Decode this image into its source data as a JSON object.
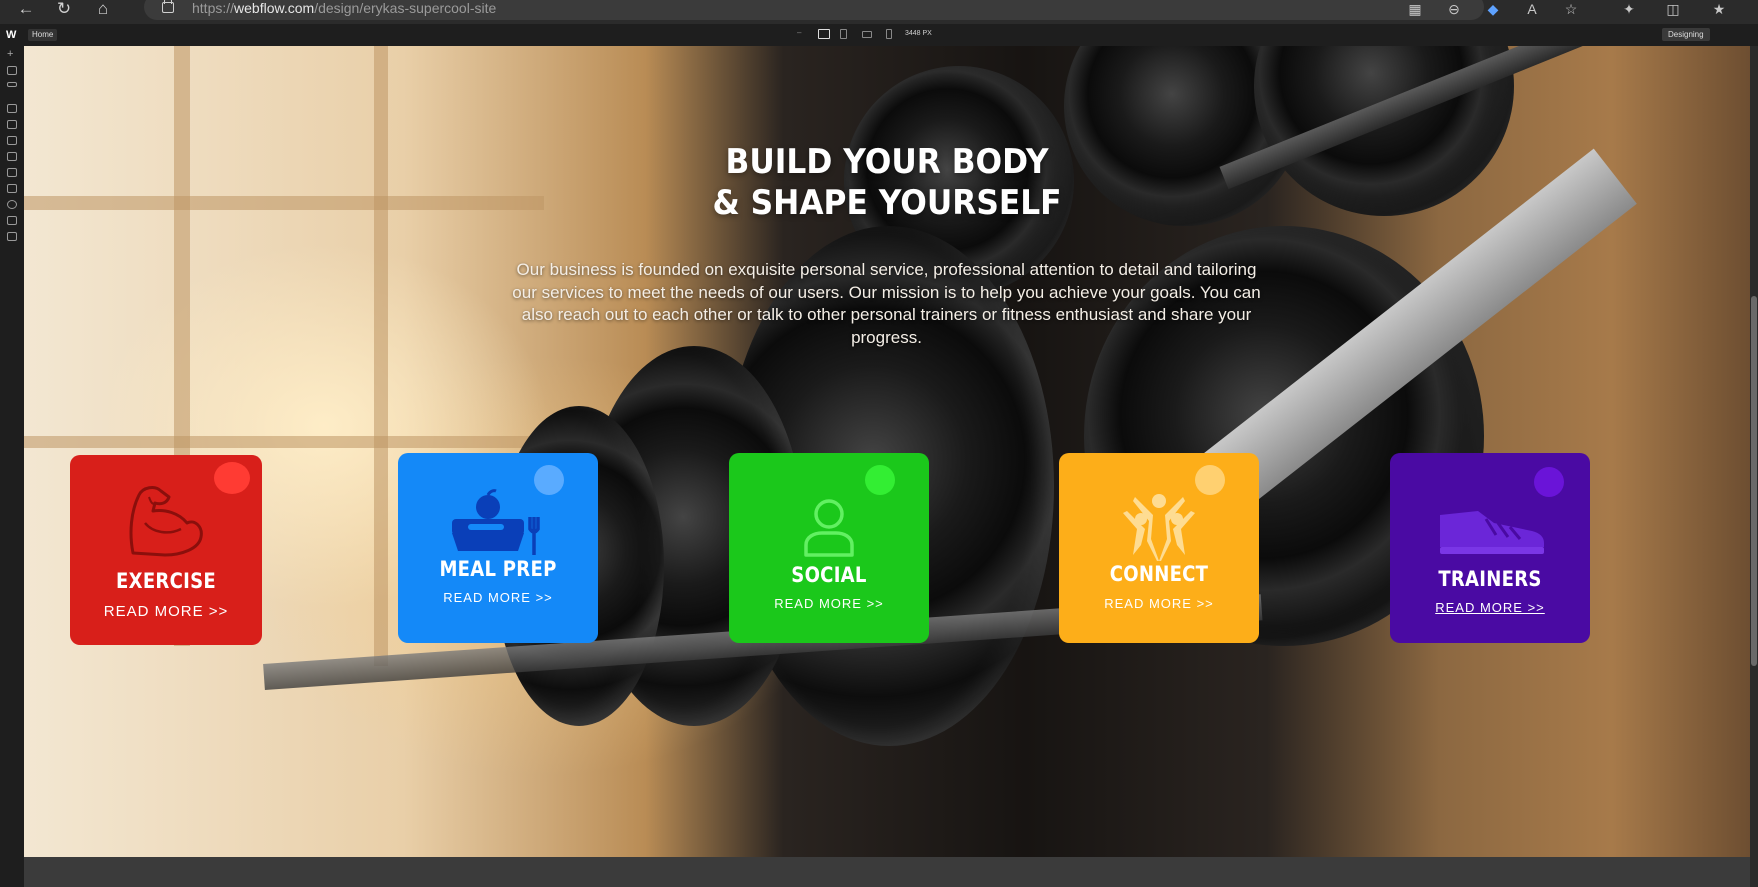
{
  "browser": {
    "url_prefix": "https://",
    "url_domain": "webflow.com",
    "url_path": "/design/erykas-supercool-site"
  },
  "designer": {
    "logo": "W",
    "page_name": "Home",
    "canvas_width": "3448 PX",
    "mode": "Designing"
  },
  "hero": {
    "title_line1": "BUILD YOUR BODY",
    "title_line2": "& SHAPE YOURSELF",
    "description": "Our business is founded on exquisite personal service, professional attention to detail and tailoring our services to meet the needs of our users. Our mission is to help you achieve your goals. You can also reach out to each other or talk to other personal trainers or fitness enthusiast and share your progress."
  },
  "cards": [
    {
      "title": "EXERCISE",
      "more": "READ MORE >>",
      "icon": "flexed-bicep-icon",
      "color": "#d81f1a",
      "dot": "#ff3b33",
      "icon_color": "#8b0f0c"
    },
    {
      "title": "MEAL PREP",
      "more": "READ MORE >>",
      "icon": "meal-prep-icon",
      "color": "#1489f8",
      "dot": "#5aabff",
      "icon_color": "#0a3fb8"
    },
    {
      "title": "SOCIAL",
      "more": "READ MORE >>",
      "icon": "person-icon",
      "color": "#1bc81b",
      "dot": "#33ee33",
      "icon_color": "#62f062"
    },
    {
      "title": "CONNECT",
      "more": "READ MORE >>",
      "icon": "people-cheering-icon",
      "color": "#fdae19",
      "dot": "#ffd070",
      "icon_color": "#ffe2a0"
    },
    {
      "title": "TRAINERS",
      "more": "READ MORE >>",
      "icon": "sneaker-icon",
      "color": "#4a0aa3",
      "dot": "#6a14d8",
      "icon_color": "#6b26d8"
    }
  ]
}
